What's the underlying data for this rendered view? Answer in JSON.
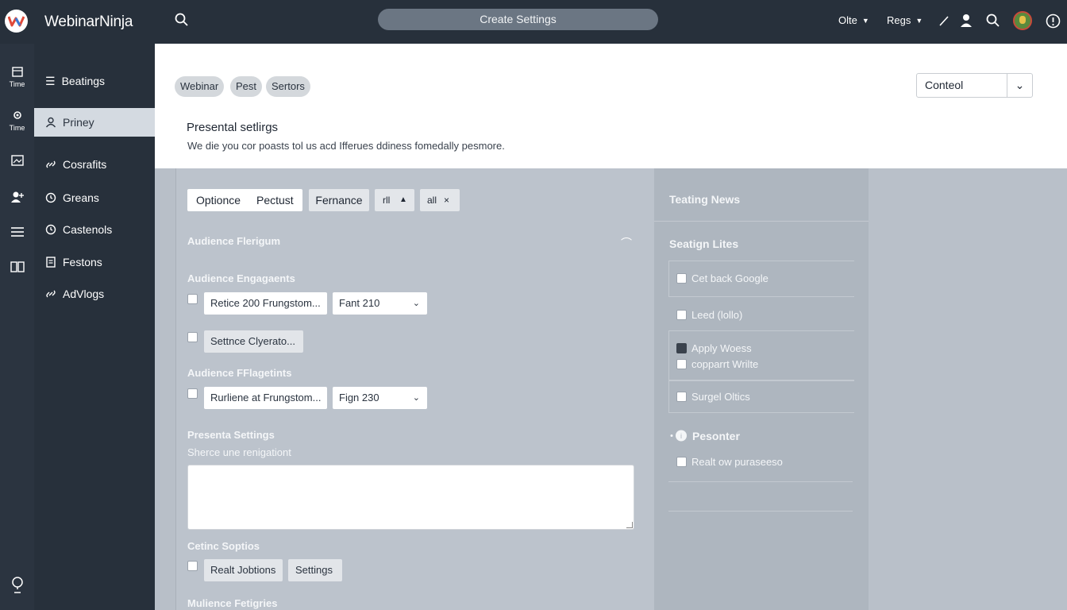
{
  "app": {
    "brand": "WebinarNinja",
    "create_button": "Create Settings",
    "menus": [
      "Olte",
      "Regs"
    ]
  },
  "rail": [
    {
      "icon": "calendar-icon",
      "label": "Time"
    },
    {
      "icon": "settings-icon",
      "label": "Time"
    },
    {
      "icon": "image-icon",
      "label": ""
    },
    {
      "icon": "users-icon",
      "label": ""
    },
    {
      "icon": "list-icon",
      "label": ""
    },
    {
      "icon": "book-icon",
      "label": ""
    },
    {
      "icon": "help-icon",
      "label": ""
    }
  ],
  "nav": {
    "items": [
      {
        "label": "Beatings",
        "icon": "menu-icon",
        "active": false
      },
      {
        "label": "Priney",
        "icon": "user-icon",
        "active": true
      },
      {
        "label": "Cosrafits",
        "icon": "link-icon",
        "active": false
      },
      {
        "label": "Greans",
        "icon": "clock-icon",
        "active": false
      },
      {
        "label": "Castenols",
        "icon": "clock-icon",
        "active": false
      },
      {
        "label": "Festons",
        "icon": "doc-icon",
        "active": false
      },
      {
        "label": "AdVlogs",
        "icon": "link-icon",
        "active": false
      }
    ]
  },
  "header": {
    "chips": [
      "Webinar",
      "Pest",
      "Sertors"
    ],
    "contact_select": "Conteol",
    "title": "Presental setlirgs",
    "description": "We die you cor poasts tol us acd Ifferues ddiness fomedally pesmore."
  },
  "content": {
    "segments": [
      "Optionce",
      "Pectust",
      "Fernance",
      "rll",
      "all"
    ],
    "section1": "Audience Flerigum",
    "section2": "Audience Engagaents",
    "row1_field": "Retice 200 Frungstom...",
    "row1_select": "Fant 210",
    "row2_field": "Settnce Clyerato...",
    "section3": "Audience FFlagetints",
    "row3_field": "Rurliene at Frungstom...",
    "row3_select": "Fign 230",
    "section4": "Presenta Settings",
    "section4_sub": "Sherce une renigationt",
    "section5": "Cetinc Soptios",
    "row5_buttons": [
      "Realt Jobtions",
      "Settings"
    ],
    "section6": "Mulience Fetigries"
  },
  "right_panel": {
    "title": "Teating News",
    "section_title": "Seatign Lites",
    "items": [
      {
        "label": "Cet back Google",
        "checked": false
      },
      {
        "label": "Leed (lollo)",
        "checked": false
      },
      {
        "label": "Apply Woess",
        "checked": true
      },
      {
        "label": "copparrt Wrilte",
        "checked": false
      },
      {
        "label": "Surgel Oltics",
        "checked": false
      }
    ],
    "presenter_title": "Pesonter",
    "presenter_item": "Realt ow puraseeso"
  },
  "colors": {
    "topbar": "#27303b",
    "sidebar": "#2b3440",
    "accent_pill": "#6b7683",
    "content_bg": "#bcc3cc"
  }
}
